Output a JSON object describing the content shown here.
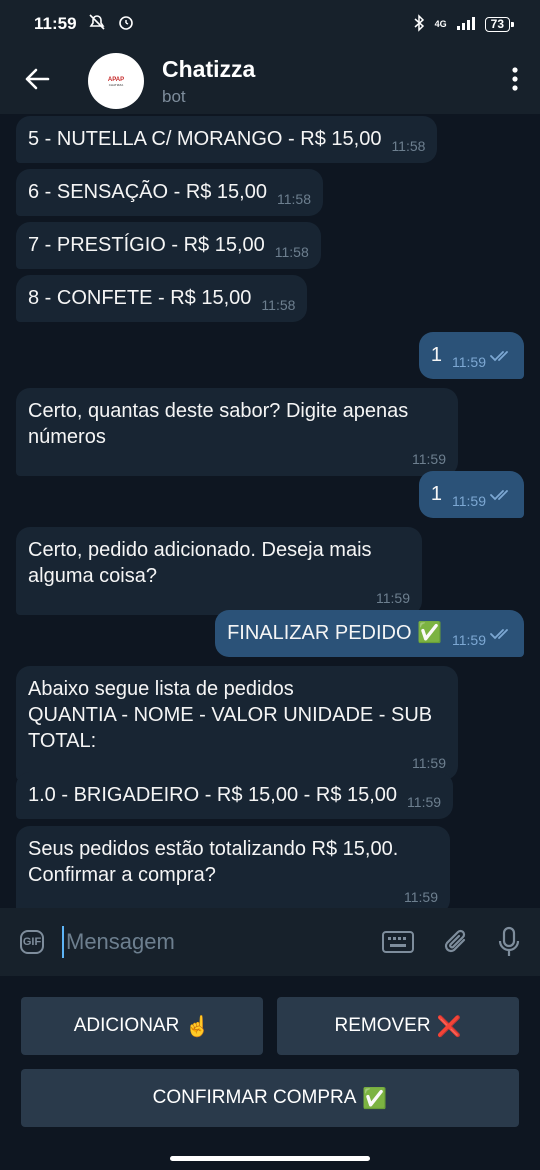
{
  "status_bar": {
    "time": "11:59",
    "network": "4G",
    "battery": "73"
  },
  "header": {
    "title": "Chatizza",
    "subtitle": "bot",
    "avatar_logo": "APAP",
    "avatar_brand": "CHATIZZA"
  },
  "messages": [
    {
      "text": "5 - NUTELLA C/ MORANGO - R$ 15,00",
      "time": "11:58",
      "dir": "in"
    },
    {
      "text": "6 - SENSAÇÃO - R$ 15,00",
      "time": "11:58",
      "dir": "in"
    },
    {
      "text": "7 - PRESTÍGIO - R$ 15,00",
      "time": "11:58",
      "dir": "in"
    },
    {
      "text": "8 - CONFETE - R$ 15,00",
      "time": "11:58",
      "dir": "in"
    },
    {
      "text": "1",
      "time": "11:59",
      "dir": "out"
    },
    {
      "text": "Certo, quantas deste sabor? Digite apenas\nnúmeros",
      "time": "11:59",
      "dir": "in"
    },
    {
      "text": "1",
      "time": "11:59",
      "dir": "out"
    },
    {
      "text": "Certo, pedido adicionado. Deseja mais\nalguma coisa?",
      "time": "11:59",
      "dir": "in"
    },
    {
      "text": "FINALIZAR PEDIDO ✅",
      "time": "11:59",
      "dir": "out"
    },
    {
      "text": "Abaixo segue lista de pedidos\nQUANTIA - NOME - VALOR UNIDADE - SUB\nTOTAL:",
      "time": "11:59",
      "dir": "in"
    },
    {
      "text": "1.0 - BRIGADEIRO - R$ 15,00 - R$ 15,00",
      "time": "11:59",
      "dir": "in"
    },
    {
      "text": "Seus pedidos estão totalizando R$ 15,00.\nConfirmar a compra?",
      "time": "11:59",
      "dir": "in"
    }
  ],
  "input": {
    "gif_label": "GIF",
    "placeholder": "Mensagem"
  },
  "keyboard": {
    "add_label": "ADICIONAR",
    "add_emoji": "☝️",
    "remove_label": "REMOVER",
    "remove_emoji": "❌",
    "confirm_label": "CONFIRMAR COMPRA",
    "confirm_emoji": "✅"
  },
  "icons": [
    "back-arrow-icon",
    "more-vertical-icon",
    "keyboard-icon",
    "paperclip-icon",
    "microphone-icon",
    "double-check-icon",
    "bluetooth-icon",
    "signal-icon",
    "battery-icon",
    "alarm-icon",
    "mute-icon"
  ],
  "colors": {
    "background": "#0e1621",
    "header": "#17212b",
    "incoming_bubble": "#182533",
    "outgoing_bubble": "#2b5278",
    "button": "#2a3a4b",
    "accent": "#5eb5f7"
  }
}
